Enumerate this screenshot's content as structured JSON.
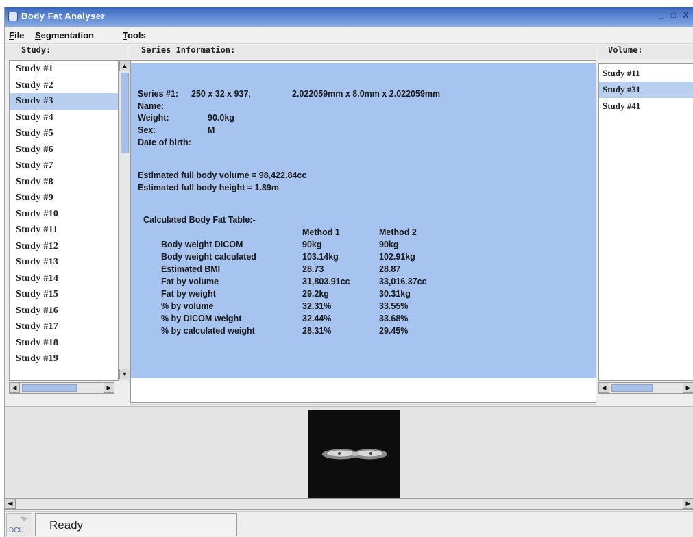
{
  "window": {
    "title": "Body Fat Analyser",
    "controls": [
      "_",
      "□",
      "X"
    ]
  },
  "menu": [
    "File",
    "Segmentation",
    "Tools"
  ],
  "panels": {
    "study_header": "Study:",
    "series_header": "Series Information:",
    "volume_header": "Volume:"
  },
  "studies": [
    "Study #1",
    "Study #2",
    "Study #3",
    "Study #4",
    "Study #5",
    "Study #6",
    "Study #7",
    "Study #8",
    "Study #9",
    "Study #10",
    "Study #11",
    "Study #12",
    "Study #13",
    "Study #14",
    "Study #15",
    "Study #16",
    "Study #17",
    "Study #18",
    "Study #19"
  ],
  "selected_study": "Study #3",
  "volumes": [
    "Study #11",
    "Study #31",
    "Study #41"
  ],
  "selected_volume": "Study #31",
  "series": {
    "series_label": "Series #1:",
    "dimensions": "250 x 32 x 937,",
    "spacing": "2.022059mm x 8.0mm x 2.022059mm",
    "name_label": "Name:",
    "weight_label": "Weight:",
    "weight_value": "90.0kg",
    "sex_label": "Sex:",
    "sex_value": "M",
    "dob_label": "Date of birth:",
    "volume_line": "Estimated full body volume = 98,422.84cc",
    "height_line": "Estimated full body height = 1.89m",
    "table_title": "Calculated Body Fat Table:-",
    "col_method1": "Method 1",
    "col_method2": "Method 2",
    "rows": [
      {
        "label": "Body weight DICOM",
        "m1": "90kg",
        "m2": "90kg"
      },
      {
        "label": "Body weight calculated",
        "m1": "103.14kg",
        "m2": "102.91kg"
      },
      {
        "label": "Estimated BMI",
        "m1": "28.73",
        "m2": "28.87"
      },
      {
        "label": "Fat by volume",
        "m1": "31,803.91cc",
        "m2": "33,016.37cc"
      },
      {
        "label": "Fat by weight",
        "m1": "29.2kg",
        "m2": "30.31kg"
      },
      {
        "label": "% by volume",
        "m1": "32.31%",
        "m2": "33.55%"
      },
      {
        "label": "% by DICOM weight",
        "m1": "32.44%",
        "m2": "33.68%"
      },
      {
        "label": "% by calculated weight",
        "m1": "28.31%",
        "m2": "29.45%"
      }
    ]
  },
  "status": {
    "text": "Ready",
    "logo": "DCU"
  },
  "colors": {
    "titlebar": "#3a64b8",
    "selection": "#b8cff0",
    "series_panel": "#a7c3ef"
  }
}
